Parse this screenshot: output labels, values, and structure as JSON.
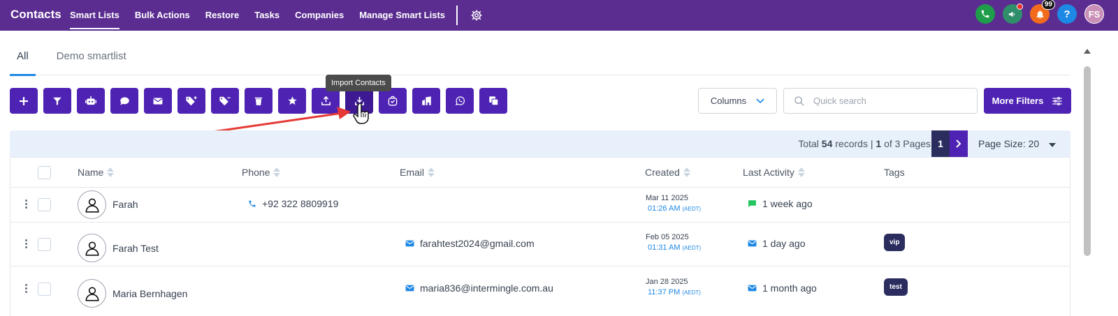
{
  "app": {
    "title": "Contacts"
  },
  "nav": {
    "items": [
      "Smart Lists",
      "Bulk Actions",
      "Restore",
      "Tasks",
      "Companies",
      "Manage Smart Lists"
    ]
  },
  "header_right": {
    "notification_count": "99",
    "avatar_initials": "FS"
  },
  "tabs": [
    "All",
    "Demo smartlist"
  ],
  "toolbar": {
    "tooltip": "Import Contacts",
    "columns_label": "Columns",
    "search_placeholder": "Quick search",
    "more_filters_label": "More Filters"
  },
  "pager": {
    "total_prefix": "Total",
    "total": "54",
    "records_word": "records |",
    "page": "1",
    "of_text": "of 3 Pages",
    "current_page": "1",
    "page_size_label": "Page Size: 20"
  },
  "table": {
    "headers": [
      "Name",
      "Phone",
      "Email",
      "Created",
      "Last Activity",
      "Tags"
    ],
    "rows": [
      {
        "name": "Farah",
        "phone": "+92 322 8809919",
        "email": "",
        "created_date": "Mar 11 2025",
        "created_time": "01:26 AM",
        "tz": "(AEDT)",
        "activity": "1 week ago",
        "activity_type": "sms",
        "tag": ""
      },
      {
        "name": "Farah Test",
        "phone": "",
        "email": "farahtest2024@gmail.com",
        "created_date": "Feb 05 2025",
        "created_time": "01:31 AM",
        "tz": "(AEDT)",
        "activity": "1 day ago",
        "activity_type": "email",
        "tag": "vip"
      },
      {
        "name": "Maria Bernhagen",
        "phone": "",
        "email": "maria836@intermingle.com.au",
        "created_date": "Jan 28 2025",
        "created_time": "11:37 PM",
        "tz": "(AEDT)",
        "activity": "1 month ago",
        "activity_type": "email",
        "tag": "test"
      }
    ]
  },
  "colors": {
    "nav_bg": "#5b2d91",
    "primary": "#4e22b3",
    "dark": "#2b2d5f",
    "link": "#1e88e5"
  }
}
